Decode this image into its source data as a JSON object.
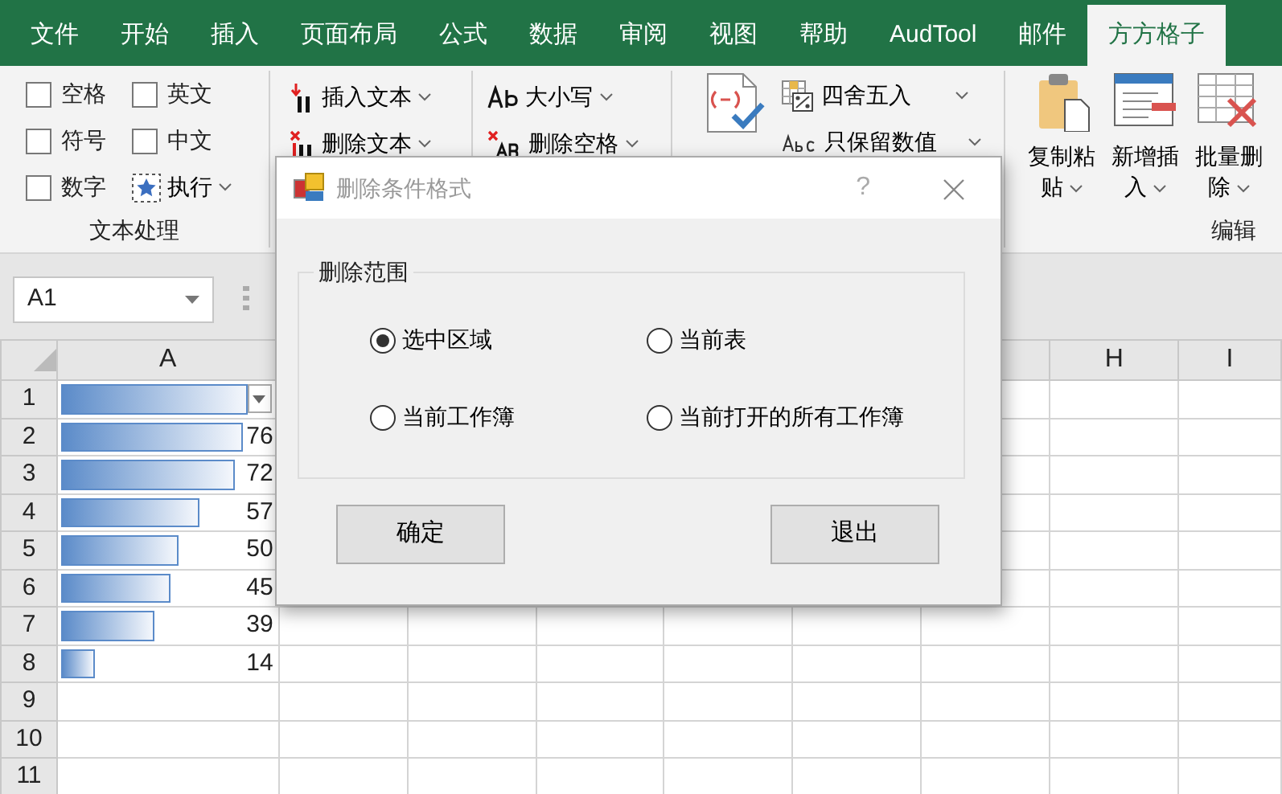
{
  "tabs": [
    {
      "label": "文件",
      "selected": false
    },
    {
      "label": "开始",
      "selected": false
    },
    {
      "label": "插入",
      "selected": false
    },
    {
      "label": "页面布局",
      "selected": false
    },
    {
      "label": "公式",
      "selected": false
    },
    {
      "label": "数据",
      "selected": false
    },
    {
      "label": "审阅",
      "selected": false
    },
    {
      "label": "视图",
      "selected": false
    },
    {
      "label": "帮助",
      "selected": false
    },
    {
      "label": "AudTool",
      "selected": false
    },
    {
      "label": "邮件",
      "selected": false
    },
    {
      "label": "方方格子",
      "selected": true
    }
  ],
  "ribbon": {
    "text_group": {
      "checkboxes": [
        {
          "label": "空格",
          "checked": false
        },
        {
          "label": "英文",
          "checked": false
        },
        {
          "label": "符号",
          "checked": false
        },
        {
          "label": "中文",
          "checked": false
        },
        {
          "label": "数字",
          "checked": false
        }
      ],
      "run_button": "执行",
      "label": "文本处理"
    },
    "text_buttons": [
      "插入文本",
      "删除文本"
    ],
    "case_buttons": [
      "大小写",
      "删除空格"
    ],
    "number_buttons": [
      "四舍五入",
      "只保留数值"
    ],
    "edit_group": {
      "buttons": [
        "复制粘贴",
        "新增插入",
        "批量删除"
      ],
      "label": "编辑"
    }
  },
  "name_box": "A1",
  "columns": [
    {
      "label": "A"
    },
    {
      "label": "H"
    },
    {
      "label": "I"
    }
  ],
  "rows": [
    {
      "number": "1",
      "level": 0.84,
      "dropdown": true
    },
    {
      "number": "2",
      "value": "76",
      "level": 0.82
    },
    {
      "number": "3",
      "value": "72",
      "level": 0.78
    },
    {
      "number": "4",
      "value": "57",
      "level": 0.62
    },
    {
      "number": "5",
      "value": "50",
      "level": 0.53
    },
    {
      "number": "6",
      "value": "45",
      "level": 0.49
    },
    {
      "number": "7",
      "value": "39",
      "level": 0.42
    },
    {
      "number": "8",
      "value": "14",
      "level": 0.15
    },
    {
      "number": "9"
    },
    {
      "number": "10"
    },
    {
      "number": "11"
    }
  ],
  "dialog": {
    "title": "删除条件格式",
    "help": "?",
    "group_label": "删除范围",
    "options": [
      {
        "label": "选中区域",
        "selected": true
      },
      {
        "label": "当前表",
        "selected": false
      },
      {
        "label": "当前工作簿",
        "selected": false
      },
      {
        "label": "当前打开的所有工作簿",
        "selected": false
      }
    ],
    "buttons": [
      "确定",
      "退出"
    ]
  }
}
